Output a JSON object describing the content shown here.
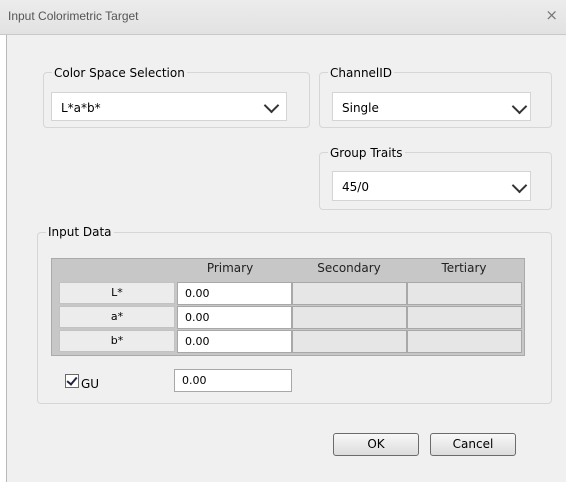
{
  "window": {
    "title": "Input Colorimetric Target",
    "close_glyph": "×"
  },
  "color_space": {
    "label": "Color Space Selection",
    "value": "L*a*b*"
  },
  "channel_id": {
    "label": "ChannelID",
    "value": "Single"
  },
  "group_traits": {
    "label": "Group Traits",
    "value": "45/0"
  },
  "input_data": {
    "label": "Input Data",
    "columns": [
      "Primary",
      "Secondary",
      "Tertiary"
    ],
    "rows": [
      {
        "label": "L*",
        "primary": "0.00"
      },
      {
        "label": "a*",
        "primary": "0.00"
      },
      {
        "label": "b*",
        "primary": "0.00"
      }
    ]
  },
  "gu": {
    "label": "GU",
    "checked": true,
    "value": "0.00"
  },
  "buttons": {
    "ok": "OK",
    "cancel": "Cancel"
  }
}
